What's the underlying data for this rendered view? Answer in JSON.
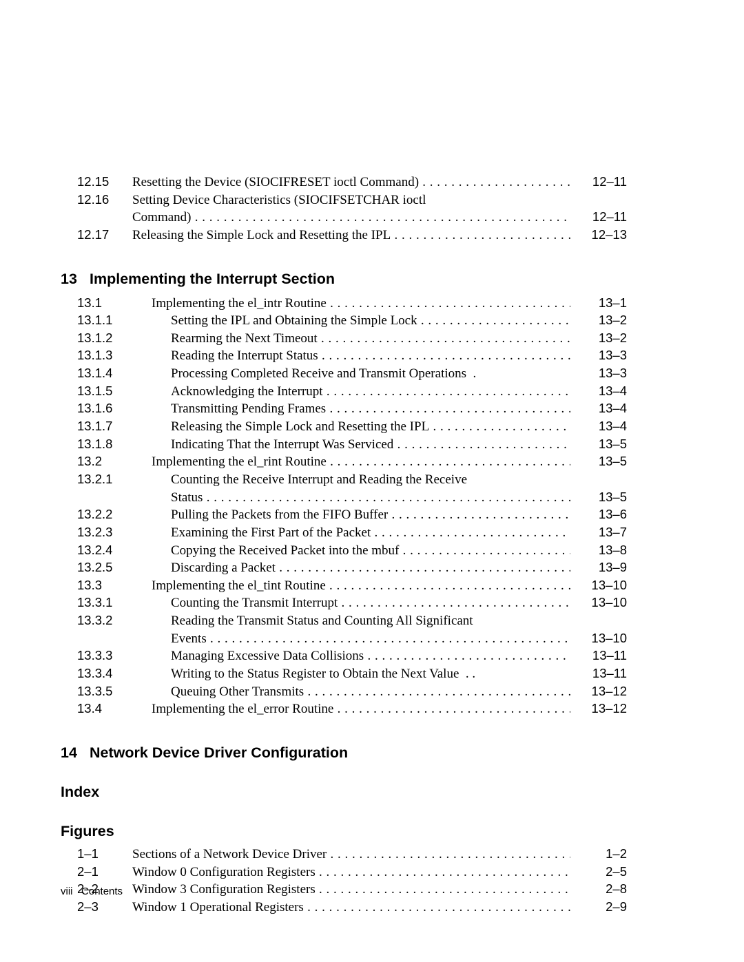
{
  "top": [
    {
      "num": "12.15",
      "title": "Resetting the Device (SIOCIFRESET ioctl Command)",
      "pg": "12–11"
    },
    {
      "num": "12.16",
      "title": "Setting Device Characteristics (SIOCIFSETCHAR ioctl",
      "cont": "Command)",
      "pg": "12–11"
    },
    {
      "num": "12.17",
      "title": "Releasing the Simple Lock and Resetting the IPL",
      "pg": "12–13"
    }
  ],
  "ch13": {
    "num": "13",
    "title": "Implementing the Interrupt Section"
  },
  "s13": [
    {
      "num": "13.1",
      "indent": false,
      "title": "Implementing the el_intr Routine",
      "pg": "13–1"
    },
    {
      "num": "13.1.1",
      "indent": true,
      "title": "Setting the IPL and Obtaining the Simple Lock",
      "pg": "13–2"
    },
    {
      "num": "13.1.2",
      "indent": true,
      "title": "Rearming the Next Timeout",
      "pg": "13–2"
    },
    {
      "num": "13.1.3",
      "indent": true,
      "title": "Reading the Interrupt Status",
      "pg": "13–3"
    },
    {
      "num": "13.1.4",
      "indent": true,
      "title": "Processing Completed Receive and Transmit Operations",
      "dot": ".",
      "pg": "13–3"
    },
    {
      "num": "13.1.5",
      "indent": true,
      "title": "Acknowledging the Interrupt",
      "pg": "13–4"
    },
    {
      "num": "13.1.6",
      "indent": true,
      "title": "Transmitting Pending Frames",
      "pg": "13–4"
    },
    {
      "num": "13.1.7",
      "indent": true,
      "title": "Releasing the Simple Lock and Resetting the IPL",
      "pg": "13–4"
    },
    {
      "num": "13.1.8",
      "indent": true,
      "title": "Indicating That the Interrupt Was Serviced",
      "pg": "13–5"
    },
    {
      "num": "13.2",
      "indent": false,
      "title": "Implementing the el_rint Routine",
      "pg": "13–5"
    },
    {
      "num": "13.2.1",
      "indent": true,
      "title": "Counting the Receive Interrupt and Reading the Receive",
      "cont": "Status",
      "pg": "13–5"
    },
    {
      "num": "13.2.2",
      "indent": true,
      "title": "Pulling the Packets from the FIFO Buffer",
      "pg": "13–6"
    },
    {
      "num": "13.2.3",
      "indent": true,
      "title": "Examining the First Part of the Packet",
      "pg": "13–7"
    },
    {
      "num": "13.2.4",
      "indent": true,
      "title": "Copying the Received Packet into the mbuf",
      "pg": "13–8"
    },
    {
      "num": "13.2.5",
      "indent": true,
      "title": "Discarding a Packet",
      "pg": "13–9"
    },
    {
      "num": "13.3",
      "indent": false,
      "title": "Implementing the el_tint Routine",
      "pg": "13–10"
    },
    {
      "num": "13.3.1",
      "indent": true,
      "title": "Counting the Transmit Interrupt",
      "pg": "13–10"
    },
    {
      "num": "13.3.2",
      "indent": true,
      "title": "Reading the Transmit Status and Counting All Significant",
      "cont": "Events",
      "pg": "13–10"
    },
    {
      "num": "13.3.3",
      "indent": true,
      "title": "Managing Excessive Data Collisions",
      "pg": "13–11"
    },
    {
      "num": "13.3.4",
      "indent": true,
      "title": "Writing to the Status Register to Obtain the Next Value",
      "dot": ". .",
      "pg": "13–11"
    },
    {
      "num": "13.3.5",
      "indent": true,
      "title": "Queuing Other Transmits",
      "pg": "13–12"
    },
    {
      "num": "13.4",
      "indent": false,
      "title": "Implementing the el_error Routine",
      "pg": "13–12"
    }
  ],
  "ch14": {
    "num": "14",
    "title": "Network Device Driver Configuration"
  },
  "index_head": "Index",
  "figures_head": "Figures",
  "figs": [
    {
      "num": "1–1",
      "title": "Sections of a Network Device Driver",
      "pg": "1–2"
    },
    {
      "num": "2–1",
      "title": "Window 0 Configuration Registers",
      "pg": "2–5"
    },
    {
      "num": "2–2",
      "title": "Window 3 Configuration Registers",
      "pg": "2–8"
    },
    {
      "num": "2–3",
      "title": "Window 1 Operational Registers",
      "pg": "2–9"
    }
  ],
  "footer": {
    "roman": "viii",
    "label": "Contents"
  }
}
